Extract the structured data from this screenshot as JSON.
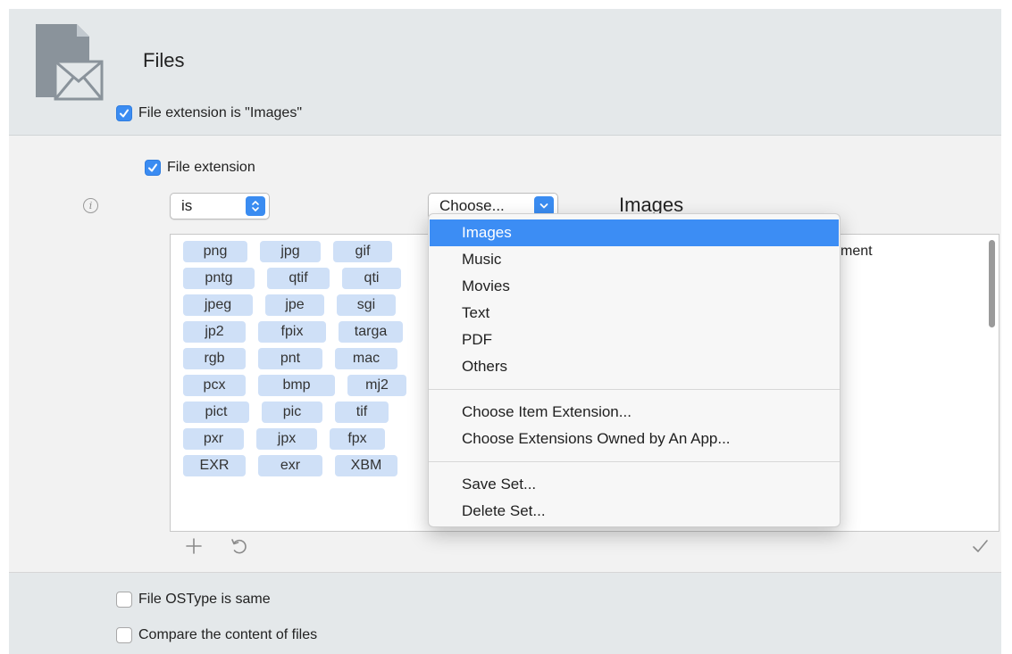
{
  "header": {
    "title": "Files",
    "file_extension_rule": "File extension is \"Images\""
  },
  "condition": {
    "checkbox_label": "File extension",
    "operator": "is",
    "chooser_label": "Choose...",
    "selected_set": "Images"
  },
  "extensions": {
    "rows": [
      [
        "png",
        "jpg",
        "gif"
      ],
      [
        "pntg",
        "qtif",
        "qti"
      ],
      [
        "jpeg",
        "jpe",
        "sgi"
      ],
      [
        "jp2",
        "fpix",
        "targa"
      ],
      [
        "rgb",
        "pnt",
        "mac"
      ],
      [
        "pcx",
        "bmp",
        "mj2"
      ],
      [
        "pict",
        "pic",
        "tif"
      ],
      [
        "pxr",
        "jpx",
        "fpx"
      ],
      [
        "EXR",
        "exr",
        "XBM"
      ]
    ],
    "right_column_text": "ment"
  },
  "menu": {
    "group1": [
      "Images",
      "Music",
      "Movies",
      "Text",
      "PDF",
      "Others"
    ],
    "active": "Images",
    "group2": [
      "Choose Item Extension...",
      "Choose Extensions Owned by An App..."
    ],
    "group3": [
      "Save Set...",
      "Delete Set..."
    ]
  },
  "footer": {
    "ostype_label": "File OSType is same",
    "content_label": "Compare the content of files"
  },
  "colors": {
    "accent": "#3b8cf2",
    "chip": "#cfe0f7",
    "menu_highlight": "#3c8df4"
  },
  "icons": [
    "file-envelope-icon",
    "checkmark-icon",
    "info-icon",
    "stepper-icon",
    "chevron-down-icon",
    "plus-icon",
    "revert-icon",
    "confirm-check-icon"
  ]
}
